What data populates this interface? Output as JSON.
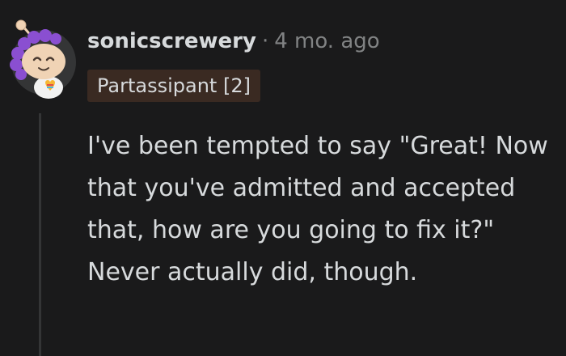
{
  "comment": {
    "author": "sonicscrewery",
    "separator": "·",
    "timestamp": "4 mo. ago",
    "flair": "Partassipant [2]",
    "avatar_icon": "snoo-avatar-icon",
    "body": "I've been tempted to say \"Great! Now that you've admitted and accepted that, how are you going to fix it?\" Never actually did, though."
  },
  "colors": {
    "background": "#1a1a1b",
    "text": "#d7dadc",
    "muted": "#818384",
    "flair_bg": "#3a2a22",
    "thread_line": "#343536"
  }
}
